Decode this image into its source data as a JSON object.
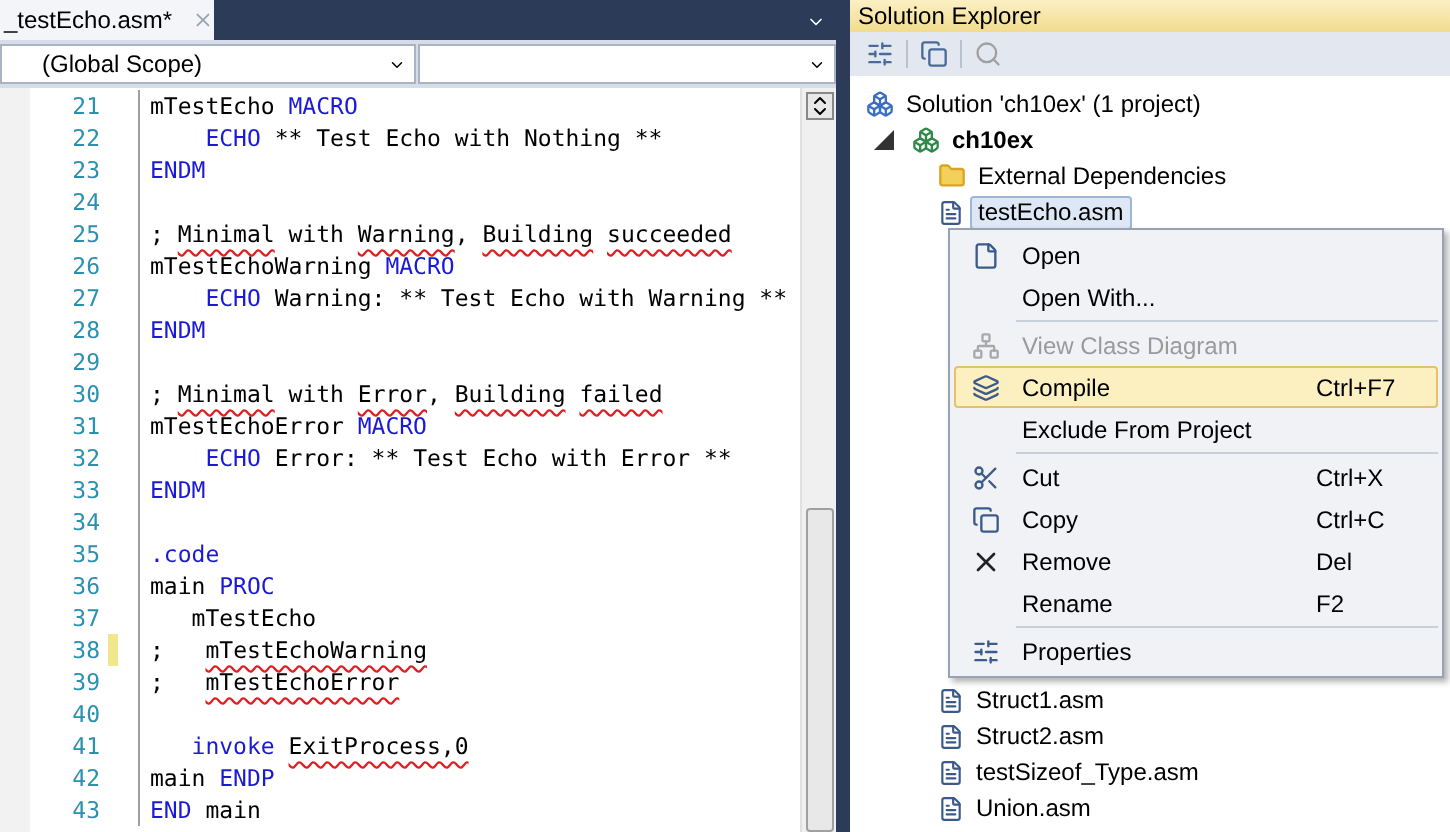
{
  "editor": {
    "tab": {
      "title": "_testEcho.asm*",
      "selected": true
    },
    "scope": {
      "value": "(Global Scope)"
    },
    "lines": [
      {
        "number": "21",
        "changed": false,
        "segments": [
          {
            "text": "mTestEcho ",
            "kind": "plain"
          },
          {
            "text": "MACRO",
            "kind": "keyword"
          }
        ]
      },
      {
        "number": "22",
        "changed": false,
        "segments": [
          {
            "text": "    ECHO",
            "kind": "keyword"
          },
          {
            "text": " ** Test Echo with Nothing **",
            "kind": "plain"
          }
        ]
      },
      {
        "number": "23",
        "changed": false,
        "segments": [
          {
            "text": "ENDM",
            "kind": "keyword"
          }
        ]
      },
      {
        "number": "24",
        "changed": false
      },
      {
        "number": "25",
        "changed": false,
        "segments": [
          {
            "text": "; ",
            "kind": "plain"
          },
          {
            "text": "Minimal",
            "kind": "squiggle"
          },
          {
            "text": " with ",
            "kind": "plain"
          },
          {
            "text": "Warning",
            "kind": "squiggle"
          },
          {
            "text": ", ",
            "kind": "plain"
          },
          {
            "text": "Building",
            "kind": "squiggle"
          },
          {
            "text": " succeeded",
            "kind": "squiggle"
          }
        ]
      },
      {
        "number": "26",
        "changed": false,
        "segments": [
          {
            "text": "mTestEchoWarning ",
            "kind": "plain"
          },
          {
            "text": "MACRO",
            "kind": "keyword"
          }
        ]
      },
      {
        "number": "27",
        "changed": false,
        "segments": [
          {
            "text": "    ECHO",
            "kind": "keyword"
          },
          {
            "text": " Warning: ** Test Echo with Warning **",
            "kind": "plain"
          }
        ]
      },
      {
        "number": "28",
        "changed": false,
        "segments": [
          {
            "text": "ENDM",
            "kind": "keyword"
          }
        ]
      },
      {
        "number": "29",
        "changed": false
      },
      {
        "number": "30",
        "changed": false,
        "segments": [
          {
            "text": "; ",
            "kind": "plain"
          },
          {
            "text": "Minimal",
            "kind": "squiggle"
          },
          {
            "text": " with ",
            "kind": "plain"
          },
          {
            "text": "Error",
            "kind": "squiggle"
          },
          {
            "text": ", ",
            "kind": "plain"
          },
          {
            "text": "Building",
            "kind": "squiggle"
          },
          {
            "text": " failed",
            "kind": "squiggle"
          }
        ]
      },
      {
        "number": "31",
        "changed": false,
        "segments": [
          {
            "text": "mTestEchoError ",
            "kind": "plain"
          },
          {
            "text": "MACRO",
            "kind": "keyword"
          }
        ]
      },
      {
        "number": "32",
        "changed": false,
        "segments": [
          {
            "text": "    ECHO",
            "kind": "keyword"
          },
          {
            "text": " Error: ** Test Echo with Error **",
            "kind": "plain"
          }
        ]
      },
      {
        "number": "33",
        "changed": false,
        "segments": [
          {
            "text": "ENDM",
            "kind": "keyword"
          }
        ]
      },
      {
        "number": "34",
        "changed": false
      },
      {
        "number": "35",
        "changed": false,
        "segments": [
          {
            "text": ".code",
            "kind": "keyword"
          }
        ]
      },
      {
        "number": "36",
        "changed": false,
        "segments": [
          {
            "text": "main ",
            "kind": "plain"
          },
          {
            "text": "PROC",
            "kind": "keyword"
          }
        ]
      },
      {
        "number": "37",
        "changed": false,
        "segments": [
          {
            "text": "   mTestEcho",
            "kind": "plain"
          }
        ]
      },
      {
        "number": "38",
        "changed": true,
        "segments": [
          {
            "text": ";",
            "kind": "plain"
          },
          {
            "text": "   mTestEchoWarning",
            "kind": "squiggle"
          }
        ]
      },
      {
        "number": "39",
        "changed": false,
        "segments": [
          {
            "text": ";",
            "kind": "plain"
          },
          {
            "text": "   mTestEchoError",
            "kind": "squiggle"
          }
        ]
      },
      {
        "number": "40",
        "changed": false
      },
      {
        "number": "41",
        "changed": false,
        "segments": [
          {
            "text": "   invoke",
            "kind": "keyword"
          },
          {
            "text": " ExitProcess,0",
            "kind": "squiggle"
          }
        ]
      },
      {
        "number": "42",
        "changed": false,
        "segments": [
          {
            "text": "main ",
            "kind": "plain"
          },
          {
            "text": "ENDP",
            "kind": "keyword"
          }
        ]
      },
      {
        "number": "43",
        "changed": false,
        "segments": [
          {
            "text": "END",
            "kind": "keyword"
          },
          {
            "text": " main",
            "kind": "plain"
          }
        ]
      }
    ]
  },
  "solution_explorer": {
    "title": "Solution Explorer",
    "tree": [
      {
        "label": "Solution 'ch10ex' (1 project)",
        "kind": "solution",
        "selected": false,
        "children": [
          {
            "label": "ch10ex",
            "kind": "project",
            "selected": false,
            "expanded": true,
            "children": [
              {
                "label": "External Dependencies",
                "kind": "folder",
                "selected": false
              },
              {
                "label": "testEcho.asm",
                "kind": "file",
                "selected": true
              },
              {
                "label": "Struct1.asm",
                "kind": "file",
                "selected": false
              },
              {
                "label": "Struct2.asm",
                "kind": "file",
                "selected": false
              },
              {
                "label": "testSizeof_Type.asm",
                "kind": "file",
                "selected": false
              },
              {
                "label": "Union.asm",
                "kind": "file",
                "selected": false
              }
            ]
          }
        ]
      }
    ]
  },
  "context_menu": [
    {
      "kind": "open",
      "label": "Open",
      "disabled": false,
      "selected": false
    },
    {
      "kind": "plain",
      "label": "Open With...",
      "disabled": false,
      "selected": false
    },
    {
      "kind": "separator"
    },
    {
      "kind": "diagram",
      "label": "View Class Diagram",
      "disabled": true,
      "selected": false
    },
    {
      "kind": "compile",
      "label": "Compile",
      "shortcut": "Ctrl+F7",
      "disabled": false,
      "selected": true
    },
    {
      "kind": "plain",
      "label": "Exclude From Project",
      "disabled": false,
      "selected": false
    },
    {
      "kind": "separator"
    },
    {
      "kind": "cut",
      "label": "Cut",
      "shortcut": "Ctrl+X",
      "disabled": false,
      "selected": false
    },
    {
      "kind": "copy",
      "label": "Copy",
      "shortcut": "Ctrl+C",
      "disabled": false,
      "selected": false
    },
    {
      "kind": "remove",
      "label": "Remove",
      "shortcut": "Del",
      "disabled": false,
      "selected": false
    },
    {
      "kind": "plain",
      "label": "Rename",
      "shortcut": "F2",
      "disabled": false,
      "selected": false
    },
    {
      "kind": "separator"
    },
    {
      "kind": "properties",
      "label": "Properties",
      "disabled": false,
      "selected": false
    }
  ]
}
